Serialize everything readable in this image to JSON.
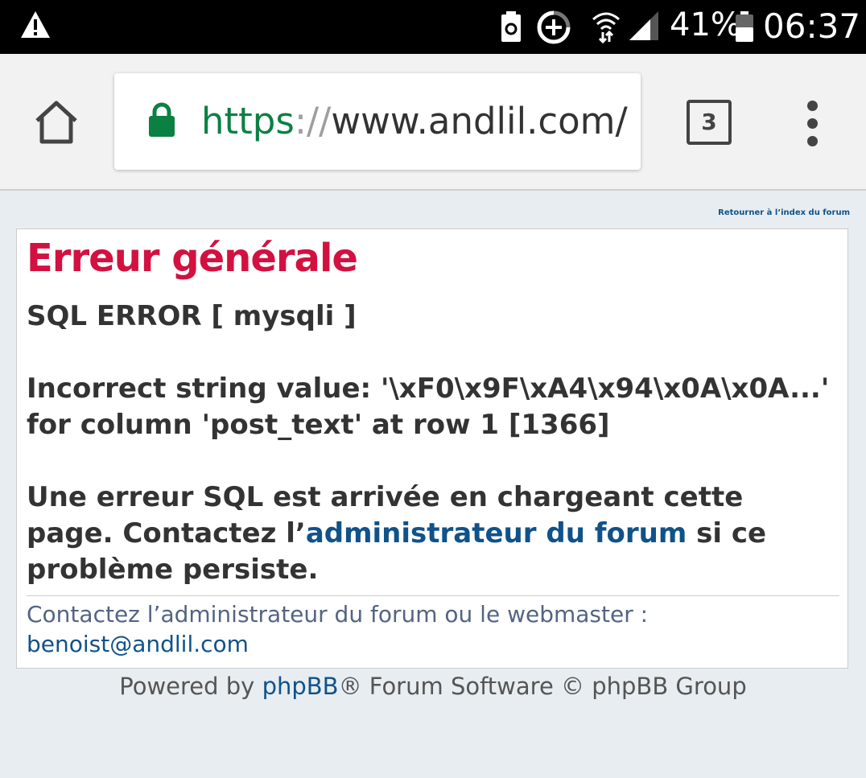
{
  "status_bar": {
    "battery_percent": "41%",
    "time": "06:37",
    "icons": [
      "warning-icon",
      "battery-saver-icon",
      "data-saver-icon",
      "wifi-icon",
      "signal-icon",
      "battery-icon"
    ]
  },
  "browser": {
    "url_scheme": "https",
    "url_sep": "://",
    "url_host": "www.andlil.com/",
    "tab_count": "3"
  },
  "page": {
    "return_link": "Retourner à l’index du forum",
    "title": "Erreur générale",
    "sql_error": "SQL ERROR [ mysqli ]",
    "error_detail": "Incorrect string value: '\\xF0\\x9F\\xA4\\x94\\x0A\\x0A...' for column 'post_text' at row 1 [1366]",
    "message_part1": "Une erreur SQL est arrivée en chargeant cette page. Contactez l’",
    "message_link": "administrateur du forum",
    "message_part2": " si ce problème persiste.",
    "contact_text": "Contactez l’administrateur du forum ou le webmaster :",
    "contact_email": "benoist@andlil.com"
  },
  "footer": {
    "powered_by": "Powered by ",
    "phpbb_link": "phpBB",
    "rest": "® Forum Software © phpBB Group"
  },
  "colors": {
    "title": "#d31141",
    "link": "#105289",
    "url_scheme": "#0b8043",
    "background": "#e7edf1"
  }
}
